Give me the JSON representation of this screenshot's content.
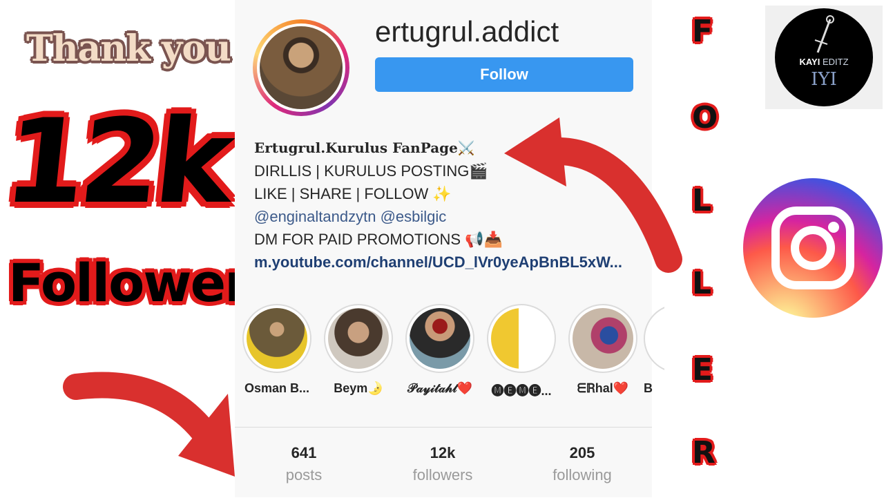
{
  "promo": {
    "thank_you": "Thank you",
    "count": "12k",
    "followers_word": "Followers",
    "vertical_letters": [
      "F",
      "O",
      "L",
      "L",
      "E",
      "R"
    ]
  },
  "brand": {
    "kayi_line1_bold": "KAYI",
    "kayi_line1_light": "EDITZ",
    "kayi_monogram": "IYI"
  },
  "profile": {
    "username": "ertugrul.addict",
    "follow_label": "Follow",
    "bio": {
      "name": "Ertugrul.Kurulus FanPage⚔️",
      "line2": "DIRLLIS | KURULUS POSTING🎬",
      "line3": "LIKE | SHARE | FOLLOW ✨",
      "mentions": "@enginaltandzytn @esbilgic",
      "line5": "DM FOR PAID PROMOTIONS 📢📥",
      "link": "m.youtube.com/channel/UCD_lVr0yeApBnBL5xW..."
    },
    "highlights": [
      {
        "label": "Osman B...",
        "color": "#6b5a3a"
      },
      {
        "label": "Beym🌛",
        "color": "#8a7a66"
      },
      {
        "label": "𝒫𝒶𝓎𝒾𝓉𝒶𝒽𝓉❤️",
        "color": "#3a2a22"
      },
      {
        "label": "🅜🅔🅜🅔...",
        "color": "#f0c830"
      },
      {
        "label": "ᗴℝhal❤️",
        "color": "#9a7a88"
      },
      {
        "label": "B",
        "color": "#cccccc"
      }
    ],
    "stats": [
      {
        "num": "641",
        "label": "posts"
      },
      {
        "num": "12k",
        "label": "followers"
      },
      {
        "num": "205",
        "label": "following"
      }
    ]
  },
  "colors": {
    "accent_red": "#e21b1b",
    "follow_blue": "#3897f0",
    "arrow_red": "#d9302e"
  }
}
